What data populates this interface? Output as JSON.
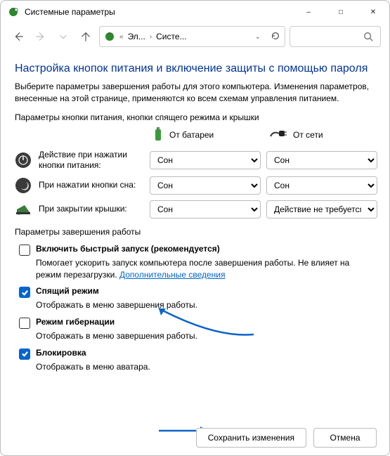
{
  "window": {
    "title": "Системные параметры"
  },
  "nav": {
    "crumb1": "Эл...",
    "crumb2": "Систе..."
  },
  "page": {
    "heading": "Настройка кнопок питания и включение защиты с помощью пароля",
    "intro": "Выберите параметры завершения работы для этого компьютера. Изменения параметров, внесенные на этой странице, применяются ко всем схемам управления питанием.",
    "section_power_buttons": "Параметры кнопки питания, кнопки спящего режима и крышки",
    "col_battery": "От батареи",
    "col_plugged": "От сети",
    "rows": {
      "power_btn": {
        "label": "Действие при нажатии кнопки питания:",
        "battery": "Сон",
        "plugged": "Сон"
      },
      "sleep_btn": {
        "label": "При нажатии кнопки сна:",
        "battery": "Сон",
        "plugged": "Сон"
      },
      "lid": {
        "label": "При закрытии крышки:",
        "battery": "Сон",
        "plugged": "Действие не требуется"
      }
    },
    "section_shutdown": "Параметры завершения работы",
    "opts": {
      "fast": {
        "label_a": "Включить быстрый запуск ",
        "label_b": "(рекомендуется)",
        "desc_a": "Помогает ускорить запуск компьютера после завершения работы. Не влияет на режим перезагрузки. ",
        "link": "Дополнительные сведения"
      },
      "sleep": {
        "label": "Спящий режим",
        "desc": "Отображать в меню завершения работы."
      },
      "hiber": {
        "label": "Режим гибернации",
        "desc": "Отображать в меню завершения работы."
      },
      "lock": {
        "label": "Блокировка",
        "desc": "Отображать в меню аватара."
      }
    }
  },
  "footer": {
    "save": "Сохранить изменения",
    "cancel": "Отмена"
  }
}
